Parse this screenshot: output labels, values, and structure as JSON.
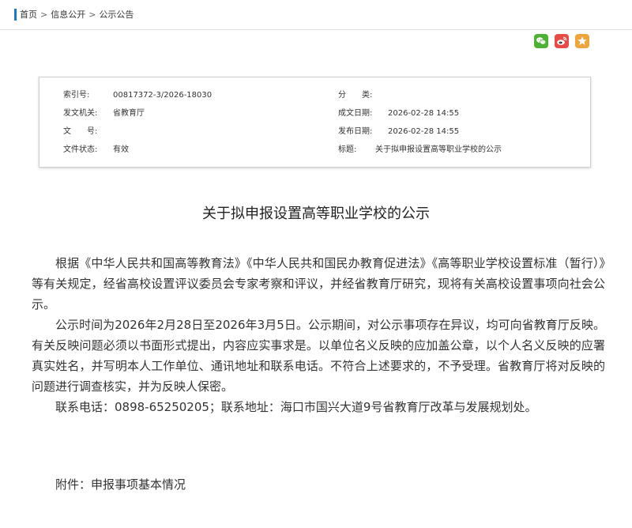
{
  "breadcrumb": {
    "items": [
      "首页",
      "信息公开",
      "公示公告"
    ],
    "separator": ">"
  },
  "share": {
    "wechat": {
      "icon": "wechat-icon",
      "color": "#4cb236"
    },
    "weibo": {
      "icon": "weibo-icon",
      "color": "#e84a47"
    },
    "favorite": {
      "icon": "star-icon",
      "color": "#f0a43c"
    }
  },
  "info": {
    "index_label": "索引号:",
    "index_value": "00817372-3/2026-18030",
    "category_label": "分　　类:",
    "category_value": "",
    "issuer_label": "发文机关:",
    "issuer_value": "省教育厅",
    "created_label": "成文日期:",
    "created_value": "2026-02-28 14:55",
    "doc_no_label": "文　　号:",
    "doc_no_value": "",
    "published_label": "发布日期:",
    "published_value": "2026-02-28 14:55",
    "status_label": "文件状态:",
    "status_value": "有效",
    "title_label": "标题:",
    "title_value": "关于拟申报设置高等职业学校的公示"
  },
  "article": {
    "title": "关于拟申报设置高等职业学校的公示",
    "paragraphs": [
      "根据《中华人民共和国高等教育法》《中华人民共和国民办教育促进法》《高等职业学校设置标准（暂行）》等有关规定，经省高校设置评议委员会专家考察和评议，并经省教育厅研究，现将有关高校设置事项向社会公示。",
      "公示时间为2026年2月28日至2026年3月5日。公示期间，对公示事项存在异议，均可向省教育厅反映。有关反映问题必须以书面形式提出，内容应实事求是。以单位名义反映的应加盖公章，以个人名义反映的应署真实姓名，并写明本人工作单位、通讯地址和联系电话。不符合上述要求的，不予受理。省教育厅将对反映的问题进行调查核实，并为反映人保密。",
      "联系电话：0898-65250205；联系地址：海口市国兴大道9号省教育厅改革与发展规划处。"
    ],
    "attachment_label": "附件：",
    "attachment_link": "申报事项基本情况"
  }
}
